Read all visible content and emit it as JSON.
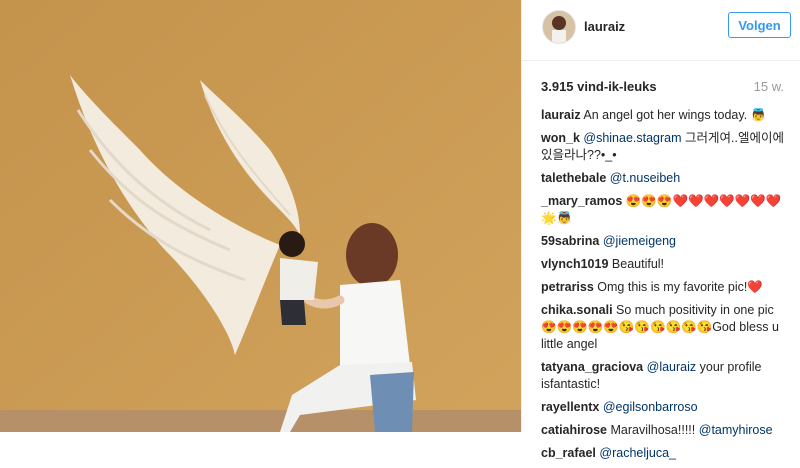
{
  "post": {
    "username": "lauraiz",
    "follow_label": "Volgen",
    "likes": "3.915 vind-ik-leuks",
    "time_ago": "15 w."
  },
  "comments": [
    {
      "user": "lauraiz",
      "mention": "",
      "text": "An angel got her wings today. 👼"
    },
    {
      "user": "won_k",
      "mention": "@shinae.stagram",
      "text": "그러게여..엘에이에 있을라나??•_•"
    },
    {
      "user": "talethebale",
      "mention": "@t.nuseibeh",
      "text": ""
    },
    {
      "user": "_mary_ramos",
      "mention": "",
      "text": "😍😍😍❤️❤️❤️❤️❤️❤️❤️🌟👼"
    },
    {
      "user": "59sabrina",
      "mention": "@jiemeigeng",
      "text": ""
    },
    {
      "user": "vlynch1019",
      "mention": "",
      "text": "Beautiful!"
    },
    {
      "user": "petrariss",
      "mention": "",
      "text": "Omg this is my favorite pic!❤️"
    },
    {
      "user": "chika.sonali",
      "mention": "",
      "text": "So much positivity in one pic 😍😍😍😍😍😘😘😘😘😘😘God bless u little angel"
    },
    {
      "user": "tatyana_graciova",
      "mention": "@lauraiz",
      "text": "your profile isfantastic!"
    },
    {
      "user": "rayellentx",
      "mention": "@egilsonbarroso",
      "text": ""
    },
    {
      "user": "catiahirose",
      "mention": "@tamyhirose",
      "text": "Maravilhosa!!!!!"
    },
    {
      "user": "cb_rafael",
      "mention": "@racheljuca_",
      "text": ""
    }
  ]
}
